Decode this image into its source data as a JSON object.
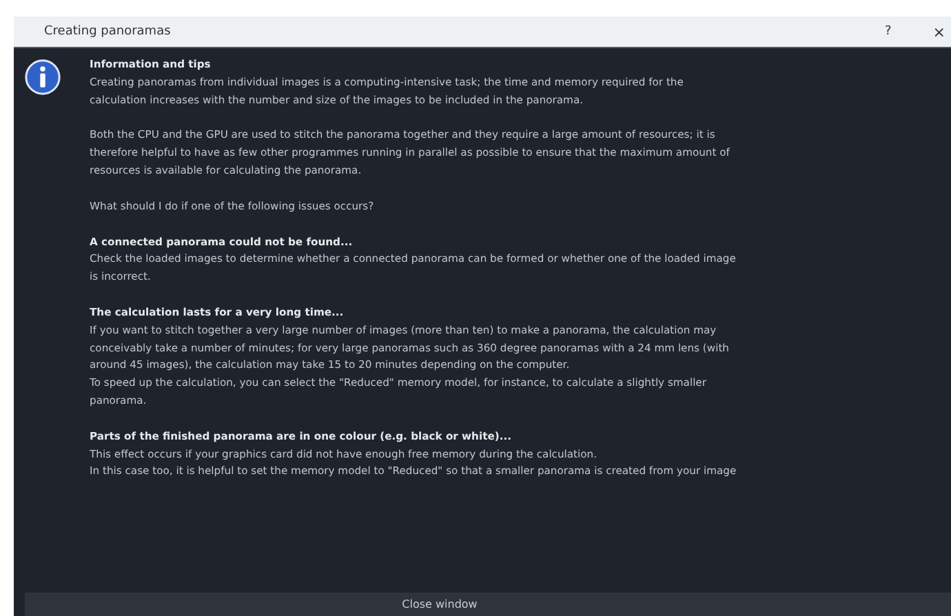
{
  "window": {
    "title": "Creating panoramas",
    "help": "?",
    "close": "×"
  },
  "sections": [
    {
      "heading": "Information and tips",
      "lines": [
        "Creating panoramas from individual images is a computing-intensive task; the time and memory required for the",
        "calculation increases with the number and size of the images to be included in the panorama."
      ]
    },
    {
      "lines": [
        "Both the CPU and the GPU are used to stitch the panorama together and they require a large amount of resources; it is",
        "therefore helpful to have as few other programmes running in parallel as possible to ensure that the maximum amount of",
        "resources is available for calculating the panorama."
      ]
    },
    {
      "lines": [
        "What should I do if one of the following issues occurs?"
      ]
    },
    {
      "heading": "A connected panorama could not be found...",
      "lines": [
        "Check the loaded images to determine whether a connected panorama can be formed or whether one of the loaded image",
        "is incorrect."
      ]
    },
    {
      "heading": "The calculation lasts for a very long time...",
      "lines": [
        "If you want to stitch together a very large number of images (more than ten) to make a panorama, the calculation may",
        "conceivably take a number of minutes; for very large panoramas such as 360 degree panoramas with a 24 mm lens (with",
        "around 45 images), the calculation may take 15 to 20 minutes depending on the computer.",
        "To speed up the calculation, you can select the \"Reduced\" memory model, for instance, to calculate a slightly smaller",
        "panorama."
      ]
    },
    {
      "heading": "Parts of the finished panorama are in one colour (e.g. black or white)...",
      "lines": [
        "This effect occurs if your graphics card did not have enough free memory during the calculation.",
        "In this case too, it is helpful to set the memory model to \"Reduced\" so that a smaller panorama is created from your image"
      ]
    }
  ],
  "button": "Close window"
}
